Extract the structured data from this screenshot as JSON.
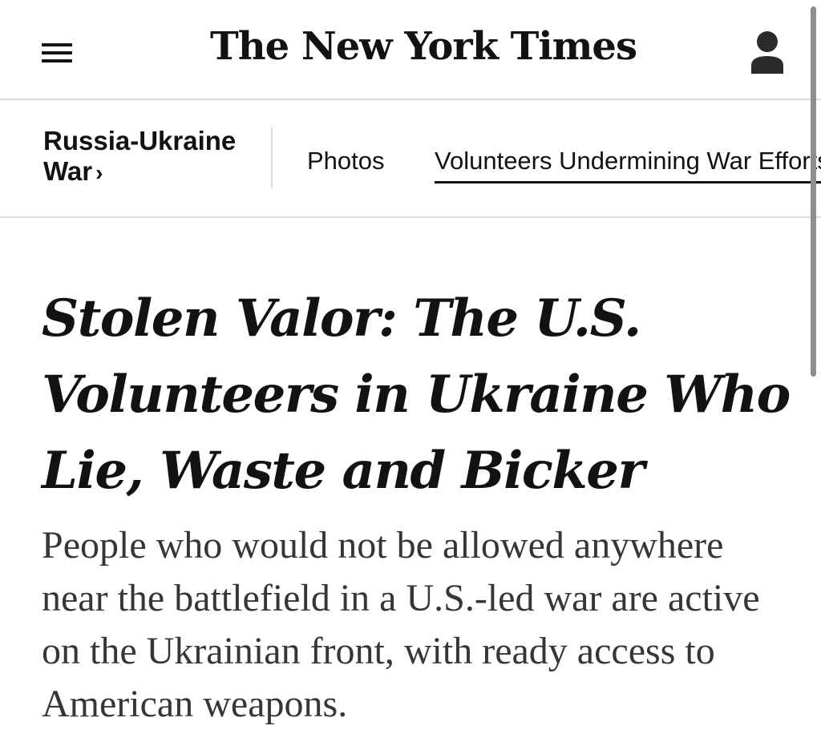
{
  "masthead": {
    "logo_text": "The New York Times",
    "menu_icon": "hamburger-menu-icon",
    "account_icon": "user-account-icon"
  },
  "section_nav": {
    "section_label": "Russia-Ukraine War",
    "section_chevron": "›",
    "tabs": [
      {
        "label": "Photos",
        "active": false
      },
      {
        "label": "Volunteers Undermining War Efforts",
        "active": true
      }
    ]
  },
  "article": {
    "headline": "Stolen Valor: The U.S. Volunteers in Ukraine Who Lie, Waste and Bicker",
    "summary": "People who would not be allowed anywhere near the battlefield in a U.S.-led war are active on the Ukrainian front, with ready access to American weapons."
  },
  "colors": {
    "text_primary": "#121212",
    "text_secondary": "#363636",
    "divider": "#dcdcdc",
    "background": "#ffffff"
  }
}
